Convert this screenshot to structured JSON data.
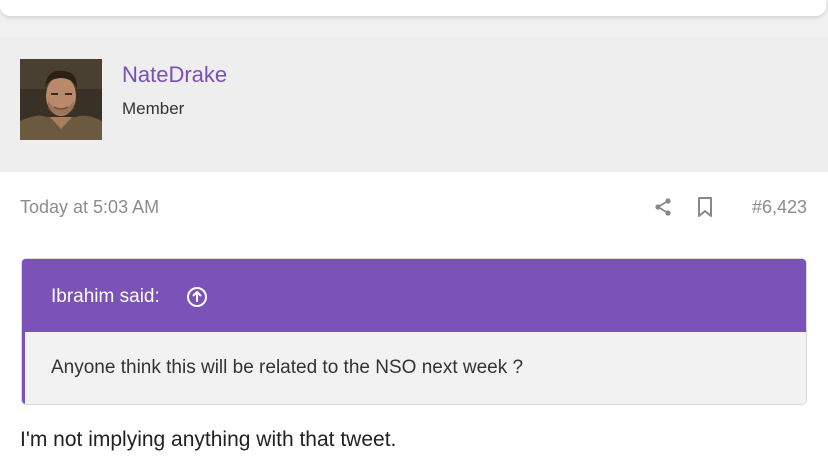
{
  "user": {
    "name": "NateDrake",
    "title": "Member"
  },
  "post": {
    "date": "Today at 5:03 AM",
    "number": "#6,423",
    "quote": {
      "author": "Ibrahim said:",
      "text": "Anyone think this will be related to the NSO next week ?"
    },
    "body": "I'm not implying anything with that tweet."
  },
  "icons": {
    "share": "share-icon",
    "bookmark": "bookmark-icon",
    "quote_jump": "arrow-up-circle-icon"
  },
  "colors": {
    "accent": "#7a52b8",
    "username": "#7a4fb7",
    "meta": "#8c8c8c"
  }
}
